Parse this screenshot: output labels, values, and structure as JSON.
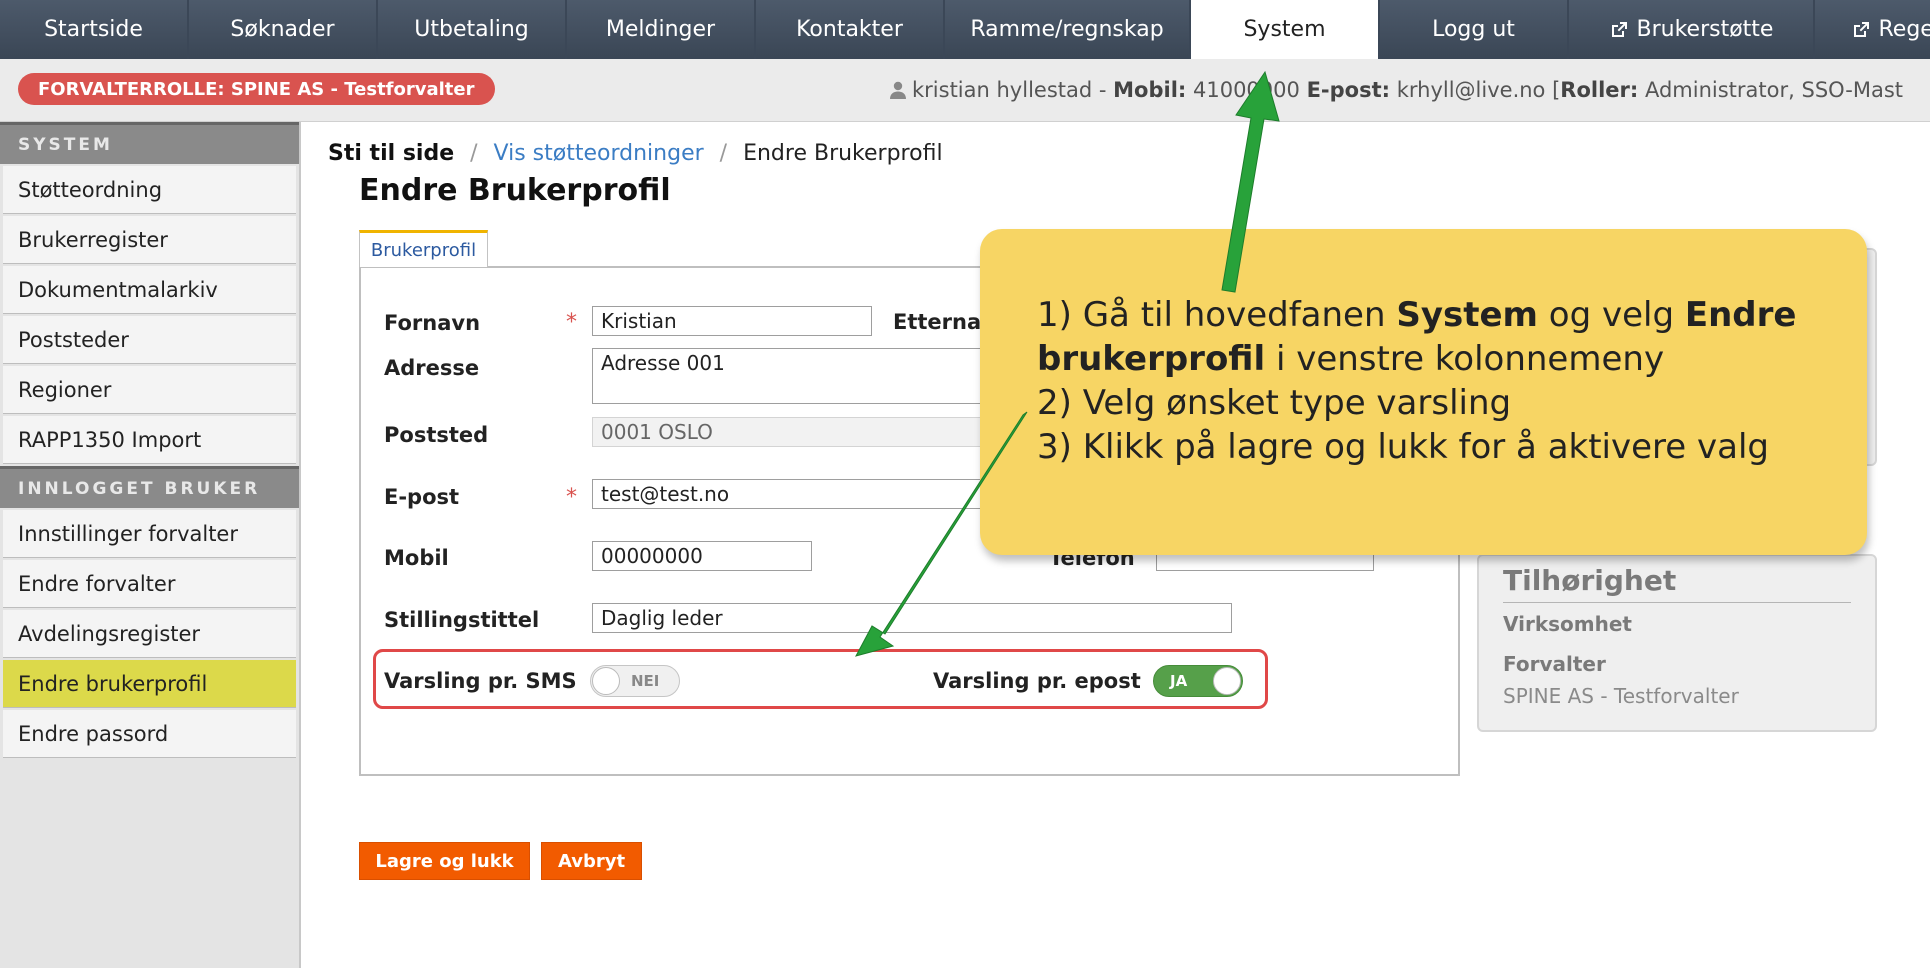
{
  "nav": {
    "tabs": [
      {
        "label": "Startside"
      },
      {
        "label": "Søknader"
      },
      {
        "label": "Utbetaling"
      },
      {
        "label": "Meldinger"
      },
      {
        "label": "Kontakter"
      },
      {
        "label": "Ramme/regnskap"
      },
      {
        "label": "System"
      },
      {
        "label": "Logg ut"
      },
      {
        "label": "Brukerstøtte",
        "icon": "external-link-icon"
      },
      {
        "label": "Regelve",
        "icon": "external-link-icon"
      }
    ],
    "active": "System"
  },
  "rolebar": {
    "badge": "FORVALTERROLLE: SPINE AS - Testforvalter",
    "user_name": "kristian hyllestad -",
    "mobil_label": "Mobil:",
    "mobil_value": "41000000",
    "epost_label": "E-post:",
    "epost_value": "krhyll@live.no",
    "roller_prefix": "[",
    "roller_label": "Roller:",
    "roller_value": "Administrator, SSO-Mast"
  },
  "sidebar": {
    "section1": "SYSTEM",
    "items1": [
      "Støtteordning",
      "Brukerregister",
      "Dokumentmalarkiv",
      "Poststeder",
      "Regioner",
      "RAPP1350 Import"
    ],
    "section2": "INNLOGGET BRUKER",
    "items2": [
      "Innstillinger forvalter",
      "Endre forvalter",
      "Avdelingsregister",
      "Endre brukerprofil",
      "Endre passord"
    ],
    "active": "Endre brukerprofil"
  },
  "breadcrumb": {
    "lead": "Sti til side",
    "sep": "/",
    "link": "Vis støtteordninger",
    "current": "Endre Brukerprofil"
  },
  "page_title": "Endre Brukerprofil",
  "tab_label": "Brukerprofil",
  "form": {
    "fornavn_label": "Fornavn",
    "fornavn_value": "Kristian",
    "etternavn_label": "Etternavn",
    "adresse_label": "Adresse",
    "adresse_value": "Adresse 001",
    "poststed_label": "Poststed",
    "poststed_value": "0001 OSLO",
    "epost_label": "E-post",
    "epost_value": "test@test.no",
    "mobil_label": "Mobil",
    "mobil_value": "00000000",
    "telefon_label": "Telefon",
    "stilling_label": "Stillingstittel",
    "stilling_value": "Daglig leder",
    "required_mark": "*",
    "sms_label": "Varsling pr. SMS",
    "sms_toggle": "NEI",
    "sms_on": false,
    "epost_varsel_label": "Varsling pr. epost",
    "epost_toggle": "JA",
    "epost_on": true
  },
  "buttons": {
    "save": "Lagre og lukk",
    "cancel": "Avbryt"
  },
  "tilhorighet": {
    "title": "Tilhørighet",
    "virksomhet_label": "Virksomhet",
    "forvalter_label": "Forvalter",
    "forvalter_value": "SPINE AS - Testforvalter"
  },
  "callout": {
    "l1_a": "1) Gå til hovedfanen ",
    "l1_b": "System",
    "l1_c": " og velg ",
    "l1_d": "Endre",
    "l2_a": "brukerprofil",
    "l2_b": " i venstre kolonnemeny",
    "l3": "2) Velg ønsket type varsling",
    "l4": "3) Klikk på lagre og lukk for å aktivere valg"
  },
  "colors": {
    "nav_bg": "#3b4757",
    "active_sidebar": "#dcd94a",
    "role_badge": "#d9534f",
    "button": "#f25b00",
    "toggle_on": "#56a04a",
    "callout": "#f7d564",
    "arrow": "#28a23a",
    "highlight_box": "#e04848"
  }
}
